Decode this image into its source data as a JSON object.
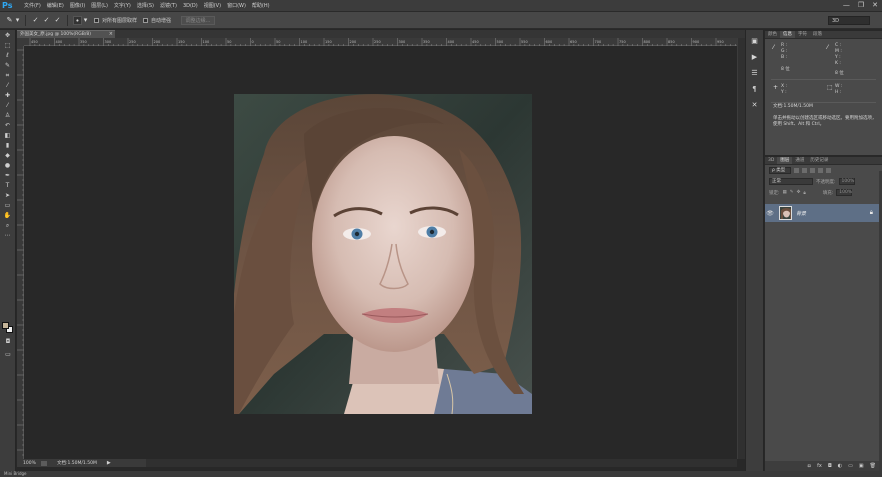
{
  "app": {
    "logo": "Ps"
  },
  "menu": {
    "items": [
      "文件(F)",
      "编辑(E)",
      "图像(I)",
      "图层(L)",
      "文字(Y)",
      "选择(S)",
      "滤镜(T)",
      "3D(D)",
      "视图(V)",
      "窗口(W)",
      "帮助(H)"
    ]
  },
  "window_controls": {
    "minimize": "—",
    "restore": "❐",
    "close": "✕"
  },
  "options_bar": {
    "checkbox1_label": "对所有图层取样",
    "checkbox2_label": "自动增强",
    "refine_button": "调整边缘...",
    "workspace": "3D"
  },
  "document": {
    "tab_title": "外国美女_原.jpg @ 100%(RGB/8)",
    "tab_close": "×",
    "zoom": "100%",
    "doc_size": "文档:1.50M/1.50M",
    "status_arrow": "▶"
  },
  "ruler_labels": [
    "450",
    "400",
    "350",
    "300",
    "250",
    "200",
    "150",
    "100",
    "50",
    "0",
    "50",
    "100",
    "150",
    "200",
    "250",
    "300",
    "350",
    "400",
    "450",
    "500",
    "550",
    "600",
    "650",
    "700",
    "750",
    "800",
    "850",
    "900",
    "950",
    "1000"
  ],
  "bottom_label": "Mini Bridge",
  "info_panel": {
    "tabs": [
      "颜色",
      "信息",
      "字符",
      "段落"
    ],
    "active_tab": 1,
    "cells": {
      "r": "R :\nG :\nB :",
      "c": "C :\nM :\nY :\nK :",
      "bit_left": "8 位",
      "bit_right": "8 位",
      "x": "X :\nY :",
      "w": "W :\nH :"
    },
    "doc_size": "文档:1.50M/1.50M",
    "hint": "单击并拖动以创建选区或移动选区。要用附加选项，使用 Shift、Alt 和 Ctrl。"
  },
  "layers_panel": {
    "tabs": [
      "3D",
      "图层",
      "通道",
      "历史记录"
    ],
    "active_tab": 1,
    "kind_label": "ρ 类型",
    "blend_mode": "正常",
    "opacity_label": "不透明度:",
    "opacity_value": "100%",
    "lock_label": "锁定:",
    "fill_label": "填充:",
    "fill_value": "100%",
    "layer_name": "背景",
    "footer_icons": [
      "ఐ",
      "fx",
      "◘",
      "◐",
      "▭",
      "▣",
      "🗑"
    ]
  },
  "colors": {
    "menubar": "#3c3c3c",
    "accent_logo": "#2fa8f3",
    "selected_layer": "#5e6f86"
  }
}
